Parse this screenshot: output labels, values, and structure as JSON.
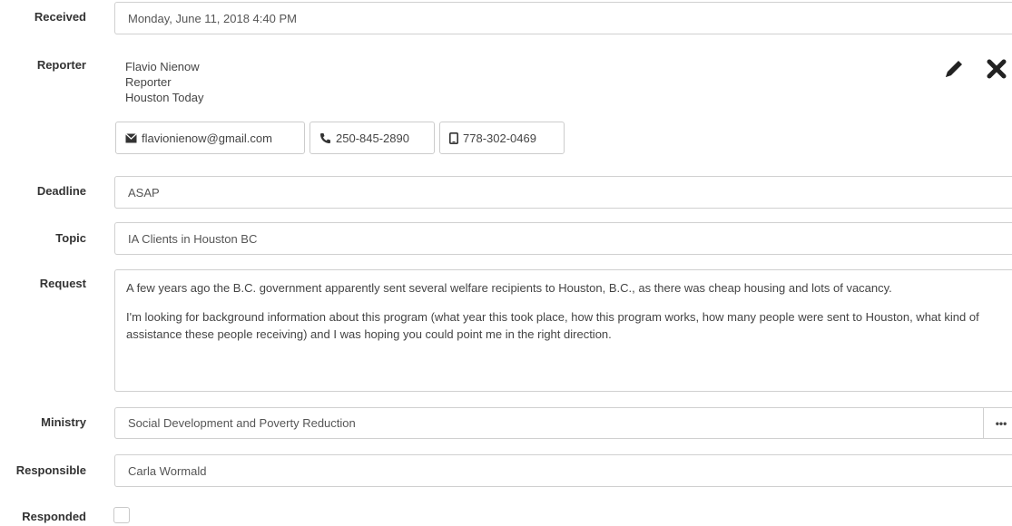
{
  "received": {
    "label": "Received",
    "value": "Monday, June 11, 2018 4:40 PM"
  },
  "reporter": {
    "label": "Reporter",
    "name": "Flavio Nienow",
    "role": "Reporter",
    "outlet": "Houston Today",
    "email": "flavionienow@gmail.com",
    "phone": "250-845-2890",
    "mobile": "778-302-0469",
    "edit_icon": "pencil-icon",
    "remove_icon": "close-icon"
  },
  "deadline": {
    "label": "Deadline",
    "value": "ASAP"
  },
  "topic": {
    "label": "Topic",
    "value": "IA Clients in Houston BC"
  },
  "request": {
    "label": "Request",
    "paragraphs": [
      "A few years ago the B.C. government apparently sent several welfare recipients to Houston, B.C., as there was cheap housing and lots of vacancy.",
      "I'm looking for background information about this program (what year this took place, how this program works, how many people were sent to Houston, what kind of assistance these people receiving) and I was hoping you could point me in the right direction."
    ]
  },
  "ministry": {
    "label": "Ministry",
    "value": "Social Development and Poverty Reduction",
    "more_label": "•••"
  },
  "responsible": {
    "label": "Responsible",
    "value": "Carla Wormald"
  },
  "responded": {
    "label": "Responded",
    "checked": false
  }
}
